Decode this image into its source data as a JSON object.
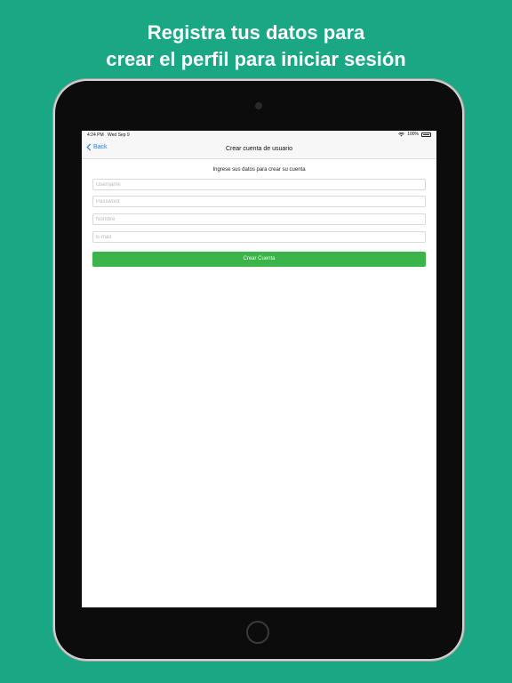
{
  "colors": {
    "background": "#1aa784",
    "accent": "#3bb54a",
    "link": "#2b7cf0"
  },
  "headline": {
    "line1": "Registra tus datos para",
    "line2": "crear el perfil para iniciar sesión"
  },
  "status_bar": {
    "time": "4:24 PM",
    "date": "Wed Sep 9",
    "battery": "100%"
  },
  "nav": {
    "back_label": "Back",
    "title": "Crear cuenta de usuario"
  },
  "form": {
    "instruction": "Ingrese sus datos para crear su cuenta",
    "username_placeholder": "Username",
    "password_placeholder": "Password",
    "name_placeholder": "Nombre",
    "email_placeholder": "E-mail",
    "submit_label": "Crear Cuenta"
  },
  "icons": {
    "back": "chevron-left-icon",
    "wifi": "wifi-icon",
    "battery": "battery-icon"
  }
}
